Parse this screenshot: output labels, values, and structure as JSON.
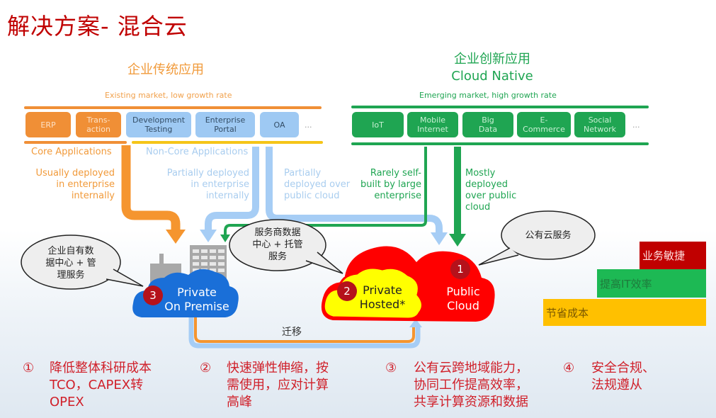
{
  "title": "解决方案- 混合云",
  "traditional": {
    "title": "企业传统应用",
    "subtitle": "Existing market, low growth rate",
    "apps": [
      {
        "label": "ERP",
        "type": "core"
      },
      {
        "label": "Trans-\naction",
        "type": "core"
      },
      {
        "label": "Development\nTesting",
        "type": "non-core"
      },
      {
        "label": "Enterprise\nPortal",
        "type": "non-core"
      },
      {
        "label": "OA",
        "type": "non-core"
      }
    ],
    "more": "...",
    "core_label": "Core Applications",
    "noncore_label": "Non-Core Applications",
    "notes": {
      "core": "Usually deployed\nin enterprise\ninternally",
      "noncore_internal": "Partially deployed\nin enterprise\ninternally",
      "noncore_public": "Partially\ndeployed over\npublic cloud"
    }
  },
  "innovative": {
    "title": "企业创新应用",
    "title_en": "Cloud Native",
    "subtitle": "Emerging market, high growth rate",
    "apps": [
      {
        "label": "IoT"
      },
      {
        "label": "Mobile\nInternet"
      },
      {
        "label": "Big\nData"
      },
      {
        "label": "E-\nCommerce"
      },
      {
        "label": "Social\nNetwork"
      }
    ],
    "more": "...",
    "notes": {
      "rare": "Rarely self-\nbuilt by large\nenterprise",
      "mostly": "Mostly\ndeployed\nover public\ncloud"
    }
  },
  "clouds": {
    "private_on_premise": {
      "badge": "3",
      "label": "Private\nOn Premise",
      "bubble": "企业自有数\n据中心 + 管\n理服务"
    },
    "private_hosted": {
      "badge": "2",
      "label": "Private\nHosted*",
      "bubble": "服务商数据\n中心 + 托管\n服务"
    },
    "public": {
      "badge": "1",
      "label": "Public\nCloud",
      "bubble": "公有云服务"
    }
  },
  "migration_label": "迁移",
  "stairs": [
    {
      "label": "业务敏捷",
      "color": "#c00000"
    },
    {
      "label": "提高IT效率",
      "color": "#1db954"
    },
    {
      "label": "节省成本",
      "color": "#ffc000"
    }
  ],
  "benefits": [
    {
      "num": "①",
      "text": "降低整体科研成本\nTCO，CAPEX转\nOPEX"
    },
    {
      "num": "②",
      "text": "快速弹性伸缩，按\n需使用，应对计算\n高峰"
    },
    {
      "num": "③",
      "text": "公有云跨地域能力，\n协同工作提高效率，\n共享计算资源和数据"
    },
    {
      "num": "④",
      "text": "安全合规、\n法规遵从"
    }
  ],
  "colors": {
    "title": "#c00000",
    "traditional": "#f08f36",
    "noncore": "#9ec9f3",
    "innovative": "#1fa552",
    "private_cloud": "#1a6fd8",
    "public_cloud": "#ff0000",
    "hosted_cloud": "#ffff00",
    "benefit_text": "#d0202a"
  }
}
